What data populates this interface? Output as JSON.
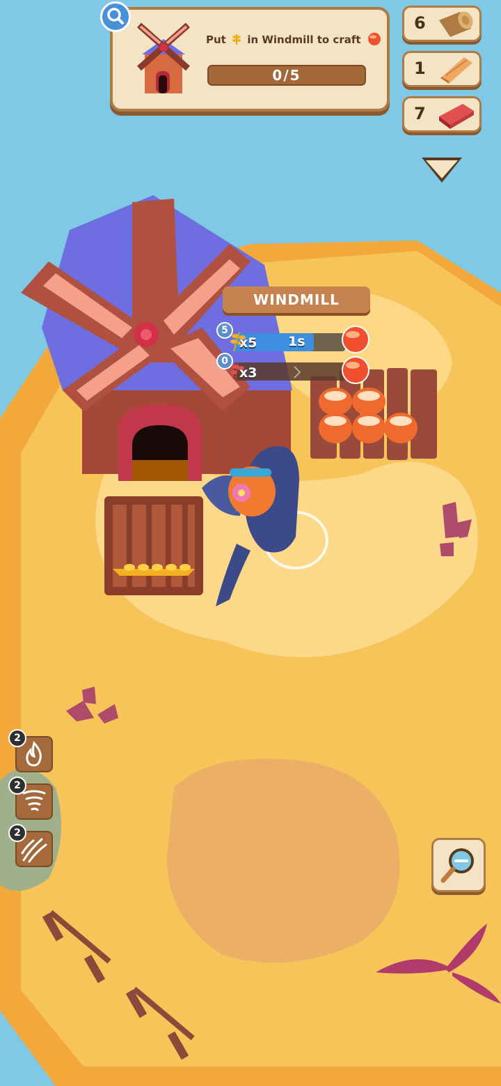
{
  "quest": {
    "prefix": "Put",
    "middle": "in Windmill to craft",
    "progress_text": "0/5",
    "progress_fraction": 0,
    "building_icon": "windmill-icon",
    "input_icon": "wheat-icon",
    "output_icon": "bread-orb-icon"
  },
  "resources": [
    {
      "count": "6",
      "icon": "wood-log-icon"
    },
    {
      "count": "1",
      "icon": "wood-plank-icon"
    },
    {
      "count": "7",
      "icon": "brick-icon"
    }
  ],
  "toggle_icon": "triangle-down-icon",
  "building": {
    "title": "WINDMILL",
    "recipes": [
      {
        "badge": "5",
        "multiplier": "x5",
        "timer": "1s",
        "progress_fraction": 0.72,
        "input_icon": "wheat-icon",
        "output_icon": "bread-orb-icon"
      },
      {
        "badge": "0",
        "multiplier": "x3",
        "timer": "",
        "progress_fraction": 0,
        "input_icon": "red-plant-icon",
        "output_icon": "bread-orb-icon"
      }
    ]
  },
  "skills": [
    {
      "badge": "2",
      "icon": "fire-icon"
    },
    {
      "badge": "2",
      "icon": "tornado-icon"
    },
    {
      "badge": "2",
      "icon": "claw-icon"
    }
  ],
  "zoom_icon": "zoom-out-icon",
  "colors": {
    "sky": "#7fc8e6",
    "sand": "#f7c45a",
    "panel": "#f4e4c6",
    "panel_border": "#b07a45",
    "roof": "#6f6ee0",
    "timer_bar": "#3e8ee0"
  }
}
